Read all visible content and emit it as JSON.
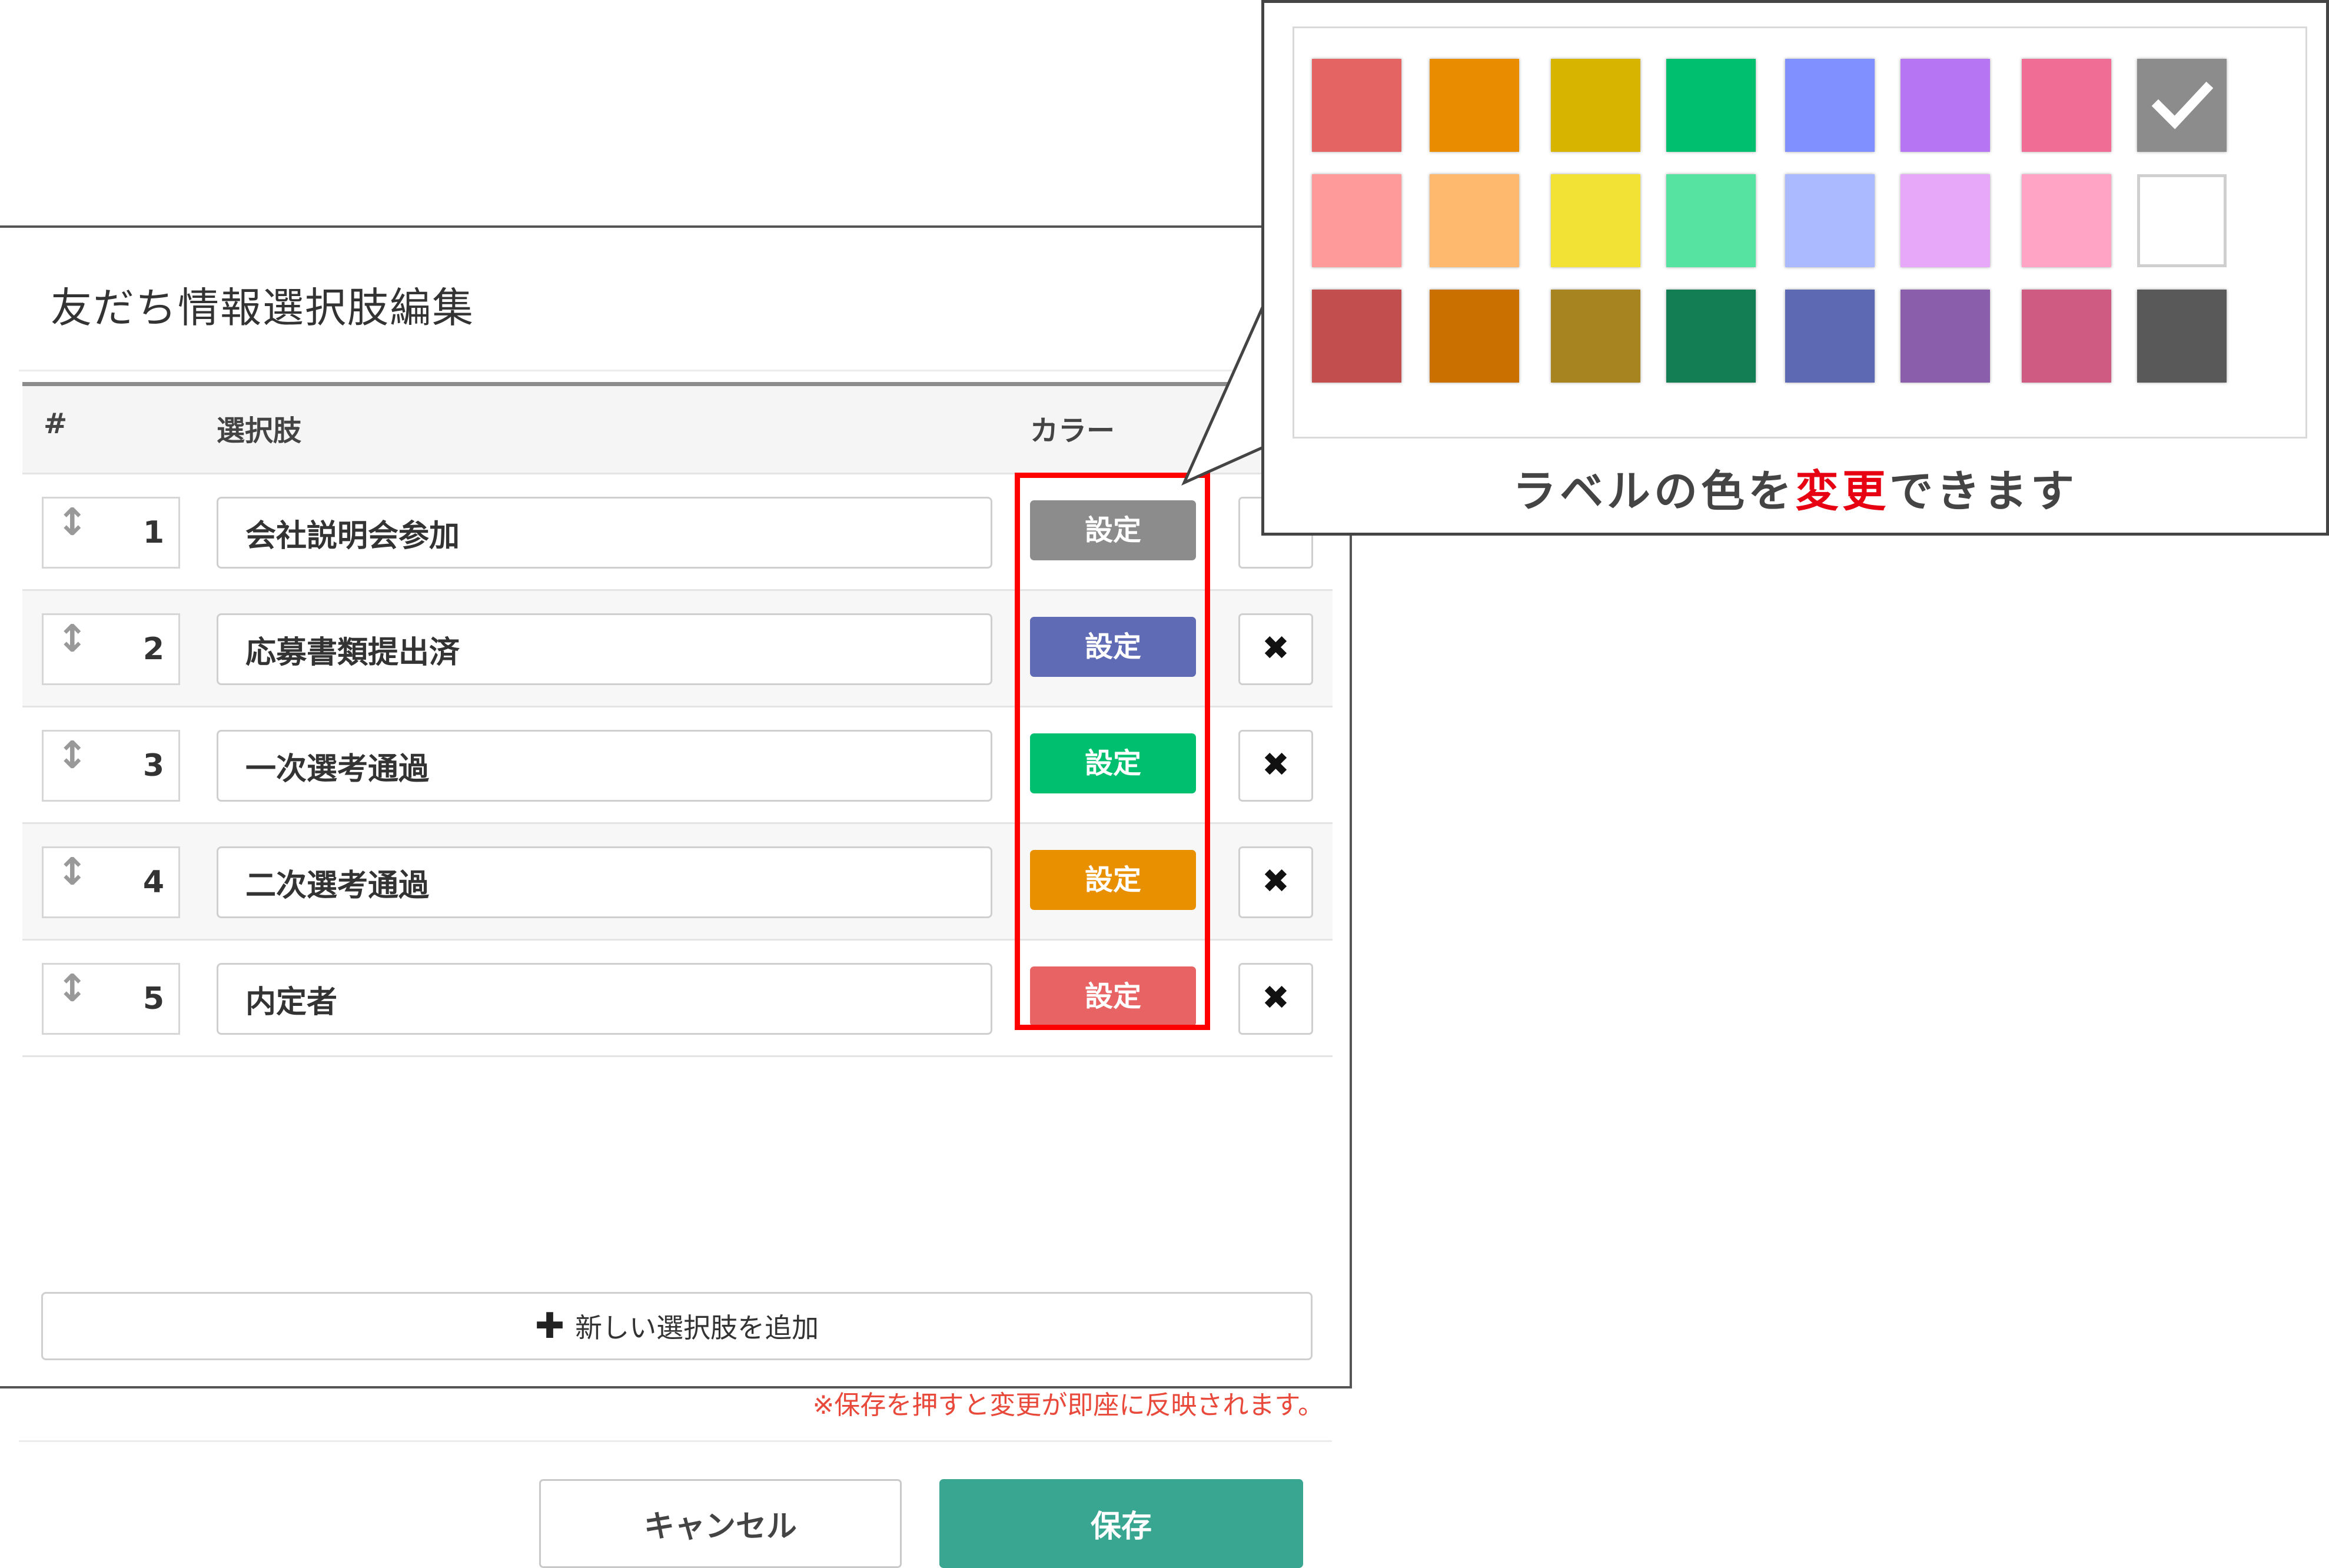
{
  "dialog": {
    "title": "友だち情報選択肢編集",
    "columns": {
      "number": "#",
      "choice": "選択肢",
      "color": "カラー"
    },
    "rows": [
      {
        "number": "1",
        "value": "会社説明会参加",
        "color_button": "設定",
        "color": "#8c8c8c",
        "has_delete": false
      },
      {
        "number": "2",
        "value": "応募書類提出済",
        "color_button": "設定",
        "color": "#5f6bb5",
        "has_delete": true
      },
      {
        "number": "3",
        "value": "一次選考通過",
        "color_button": "設定",
        "color": "#00bf6f",
        "has_delete": true
      },
      {
        "number": "4",
        "value": "二次選考通過",
        "color_button": "設定",
        "color": "#e89000",
        "has_delete": true
      },
      {
        "number": "5",
        "value": "内定者",
        "color_button": "設定",
        "color": "#e86464",
        "has_delete": true
      }
    ],
    "add_choice_label": "新しい選択肢を追加",
    "note": "※保存を押すと変更が即座に反映されます。",
    "cancel_label": "キャンセル",
    "save_label": "保存"
  },
  "callout": {
    "caption_prefix": "ラベルの色を",
    "caption_emphasis": "変更",
    "caption_suffix": "できます",
    "palette": [
      [
        "#e46464",
        "#e98c00",
        "#d6b400",
        "#00bf6f",
        "#8090ff",
        "#b676f3",
        "#f06e96",
        "#8c8c8c"
      ],
      [
        "#ff9a9a",
        "#ffb96e",
        "#f2e236",
        "#56e2a0",
        "#abbaff",
        "#e8a8fa",
        "#ffa4c4",
        "#ffffff"
      ],
      [
        "#c24e4e",
        "#c97000",
        "#a88420",
        "#137e54",
        "#5d69b2",
        "#8a5eaa",
        "#cf5a82",
        "#595959"
      ]
    ],
    "selected_swatch": "row-1-col-8"
  }
}
